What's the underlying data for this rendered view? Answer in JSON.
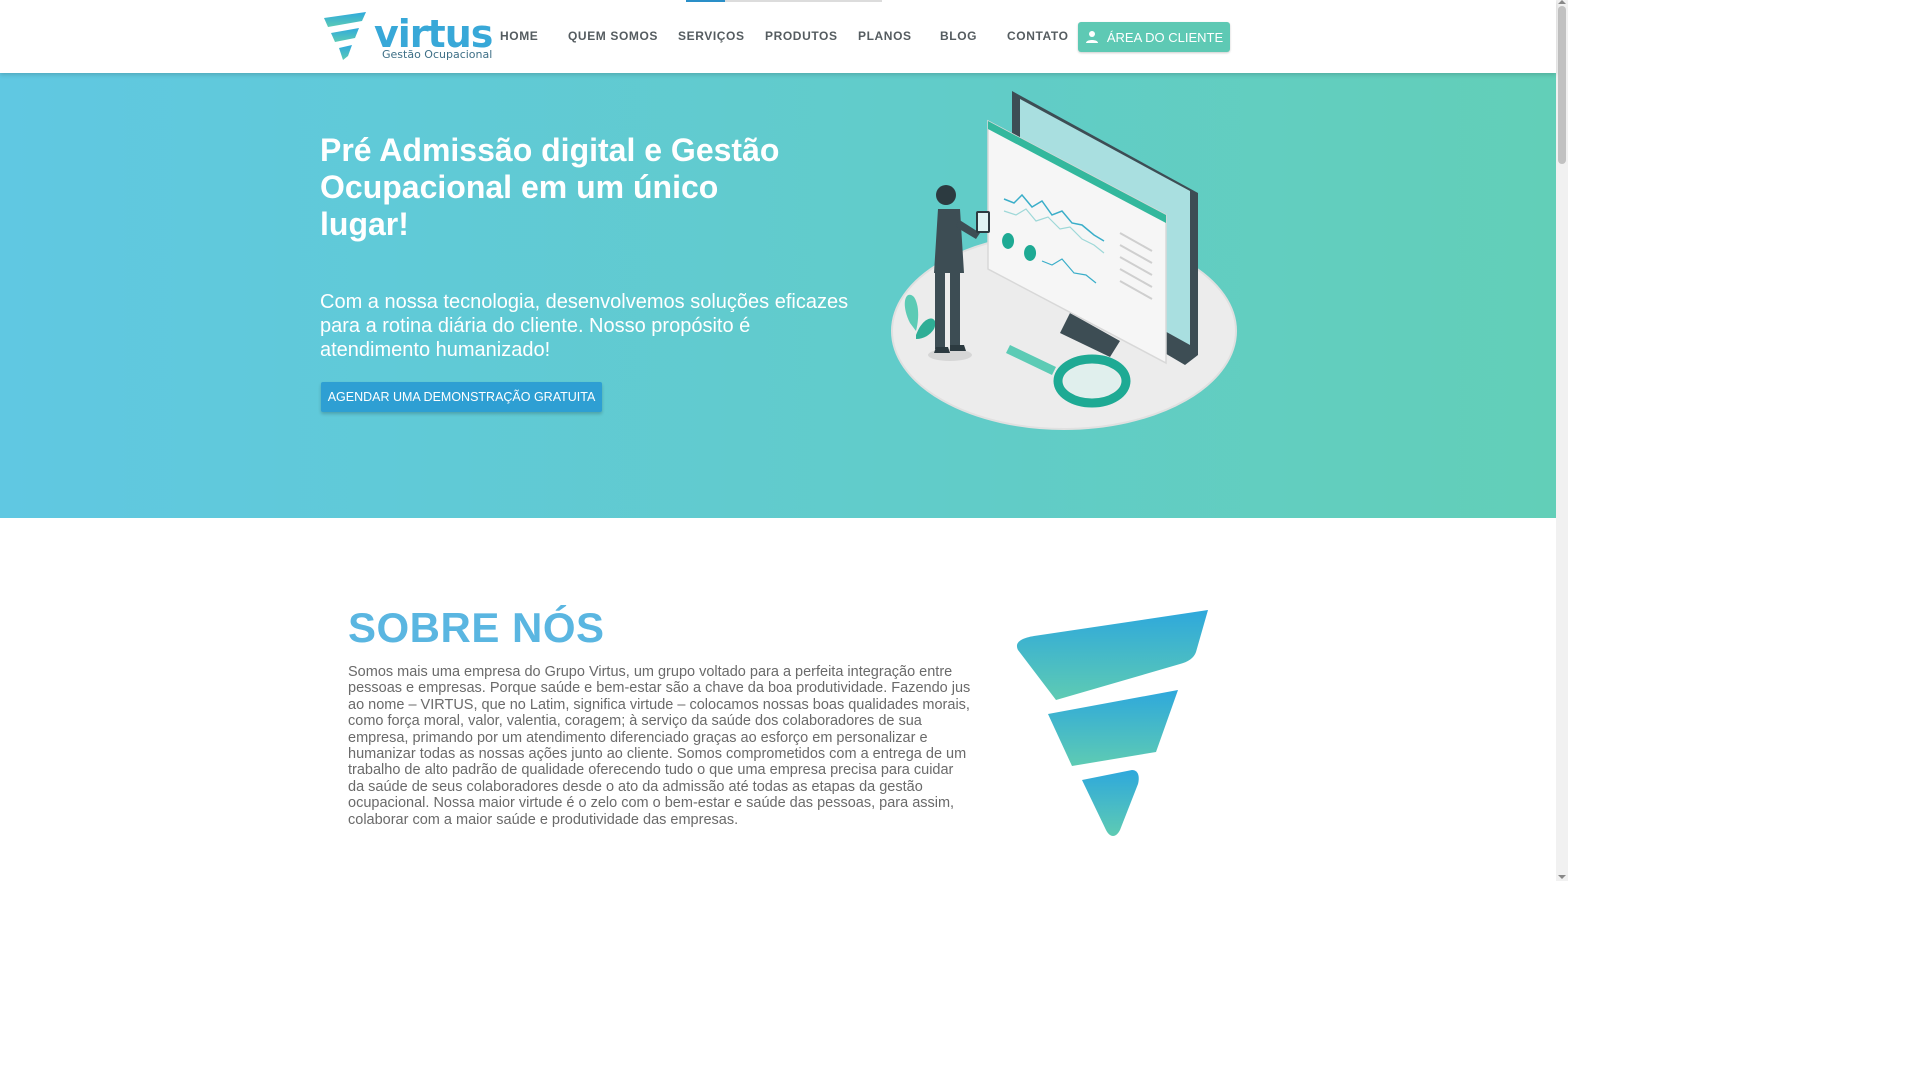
{
  "header": {
    "logo": {
      "name": "virtus",
      "tagline": "Gestão Ocupacional"
    },
    "nav": [
      {
        "label": "HOME"
      },
      {
        "label": "QUEM SOMOS"
      },
      {
        "label": "SERVIÇOS"
      },
      {
        "label": "PRODUTOS"
      },
      {
        "label": "PLANOS"
      },
      {
        "label": "BLOG"
      },
      {
        "label": "CONTATO"
      }
    ],
    "client_button": {
      "label": "ÁREA DO CLIENTE",
      "icon": "person-icon"
    }
  },
  "hero": {
    "title": "Pré Admissão digital e Gestão Ocupacional em um único lugar!",
    "text": "Com a nossa tecnologia, desenvolvemos soluções eficazes para a rotina diária do cliente. Nosso propósito é atendimento humanizado!",
    "cta": "AGENDAR UMA DEMONSTRAÇÃO GRATUITA",
    "illustration": "person-analyzing-dashboard-illustration"
  },
  "about": {
    "title": "SOBRE NÓS",
    "text": "Somos mais uma empresa do Grupo Virtus, um grupo voltado para a perfeita integração entre pessoas e empresas. Porque saúde e bem-estar são a chave da boa produtividade. Fazendo jus ao nome – VIRTUS, que no Latim, significa virtude – colocamos nossas boas qualidades morais, como força moral, valor, valentia, coragem; à serviço da saúde dos colaboradores de sua empresa, primando por um atendimento diferenciado graças ao esforço em personalizar e humanizar todas as nossas ações junto ao cliente. Somos comprometidos com a entrega de um trabalho de alto padrão de qualidade oferecendo tudo o que uma empresa precisa para cuidar da saúde de seus colaboradores desde o ato da admissão até todas as etapas da gestão ocupacional. Nossa maior virtude é o zelo com o bem-estar e saúde das pessoas, para assim, colaborar com a maior saúde e produtividade das empresas."
  },
  "colors": {
    "brand_blue": "#38a8d8",
    "brand_teal": "#5ec9b4",
    "cta_blue": "#2e9fd3",
    "about_title": "#5ab6e1"
  }
}
